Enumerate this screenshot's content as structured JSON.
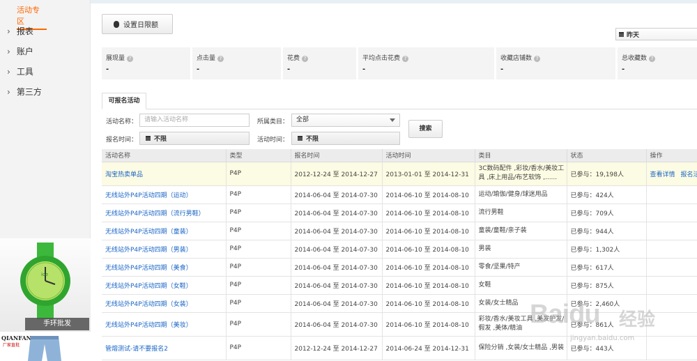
{
  "sidebar": {
    "active_label": "活动专区",
    "items": [
      {
        "label": "报表"
      },
      {
        "label": "账户"
      },
      {
        "label": "工具"
      },
      {
        "label": "第三方"
      }
    ],
    "ads": [
      {
        "caption": "手环批发"
      },
      {
        "brand": "QIANFANG",
        "brand_sub": "厂家直批"
      }
    ]
  },
  "toolbar": {
    "set_limit_label": "设置日限额",
    "date_range_value": "昨天"
  },
  "stats": [
    {
      "label": "展现量",
      "value": "-"
    },
    {
      "label": "点击量",
      "value": "-"
    },
    {
      "label": "花费",
      "value": "-"
    },
    {
      "label": "平均点击花费",
      "value": "-"
    },
    {
      "label": "收藏店铺数",
      "value": "-"
    },
    {
      "label": "总收藏数",
      "value": "-"
    }
  ],
  "tabs": [
    {
      "label": "可报名活动"
    }
  ],
  "filters": {
    "activity_name_label": "活动名称：",
    "activity_name_placeholder": "请输入活动名称",
    "category_label": "所属类目：",
    "category_value": "全部",
    "signup_time_label": "报名时间：",
    "signup_time_value": "不限",
    "activity_time_label": "活动时间：",
    "activity_time_value": "不限",
    "search_label": "搜索"
  },
  "table": {
    "headers": [
      "活动名称",
      "类型",
      "报名时间",
      "活动时间",
      "类目",
      "状态",
      "操作"
    ],
    "rows": [
      {
        "name": "淘宝热卖单品",
        "type": "P4P",
        "signup": "2012-12-24 至 2014-12-27",
        "activity": "2013-01-01 至 2014-12-31",
        "category": "3C数码配件 ,彩妆/香水/美妆工具 ,床上用品/布艺软饰 ,......",
        "status": "已参与：19,198人",
        "op_view": "查看详情",
        "op_signup": "报名活"
      },
      {
        "name": "无线站外P4P活动四期（运动）",
        "type": "P4P",
        "signup": "2014-06-04 至 2014-07-30",
        "activity": "2014-06-10 至 2014-08-10",
        "category": "运动/瑜伽/健身/球迷用品",
        "status": "已参与：424人"
      },
      {
        "name": "无线站外P4P活动四期（流行男鞋）",
        "type": "P4P",
        "signup": "2014-06-04 至 2014-07-30",
        "activity": "2014-06-10 至 2014-08-10",
        "category": "流行男鞋",
        "status": "已参与：709人"
      },
      {
        "name": "无线站外P4P活动四期（童装）",
        "type": "P4P",
        "signup": "2014-06-04 至 2014-07-30",
        "activity": "2014-06-10 至 2014-08-10",
        "category": "童装/童鞋/亲子装",
        "status": "已参与：944人"
      },
      {
        "name": "无线站外P4P活动四期（男装）",
        "type": "P4P",
        "signup": "2014-06-04 至 2014-07-30",
        "activity": "2014-06-10 至 2014-08-10",
        "category": "男装",
        "status": "已参与：1,302人"
      },
      {
        "name": "无线站外P4P活动四期（美食）",
        "type": "P4P",
        "signup": "2014-06-04 至 2014-07-30",
        "activity": "2014-06-10 至 2014-08-10",
        "category": "零食/坚果/特产",
        "status": "已参与：617人"
      },
      {
        "name": "无线站外P4P活动四期（女鞋）",
        "type": "P4P",
        "signup": "2014-06-04 至 2014-07-30",
        "activity": "2014-06-10 至 2014-08-10",
        "category": "女鞋",
        "status": "已参与：875人"
      },
      {
        "name": "无线站外P4P活动四期（女装）",
        "type": "P4P",
        "signup": "2014-06-04 至 2014-07-30",
        "activity": "2014-06-10 至 2014-08-10",
        "category": "女装/女士精品",
        "status": "已参与：2,460人"
      },
      {
        "name": "无线站外P4P活动四期（美妆）",
        "type": "P4P",
        "signup": "2014-06-04 至 2014-07-30",
        "activity": "2014-06-10 至 2014-08-10",
        "category": "彩妆/香水/美妆工具 ,美发护发/假发 ,美体/精油",
        "status": "已参与：861人"
      },
      {
        "name": "管熔测试-请不要报名2",
        "type": "P4P",
        "signup": "2012-12-24 至 2014-12-27",
        "activity": "2014-06-24 至 2014-12-31",
        "category": "保险分销 ,女装/女士精品 ,男装",
        "status": "已参与：443人"
      }
    ]
  },
  "watermark": {
    "text": "Baidu",
    "cn": "经验",
    "url": "jingyan.baidu.com"
  }
}
